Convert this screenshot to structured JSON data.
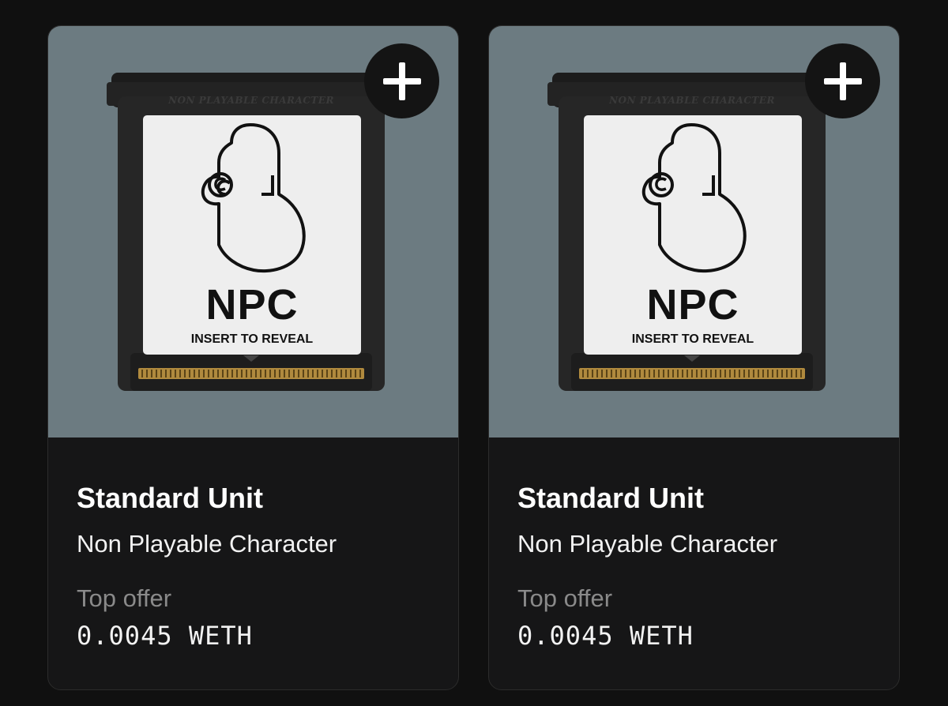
{
  "colors": {
    "page_background": "#101010",
    "card_background": "#161617",
    "media_background": "#6c7b81",
    "muted_text": "#8a8a8a"
  },
  "cards": [
    {
      "cartridge": {
        "top_text": "NON PLAYABLE CHARACTER",
        "logo_text": "NPC",
        "caption": "INSERT TO REVEAL",
        "icon": "npc-head-icon"
      },
      "add_icon": "plus-icon",
      "title": "Standard Unit",
      "collection": "Non Playable Character",
      "offer_label": "Top offer",
      "offer_value": "0.0045 WETH"
    },
    {
      "cartridge": {
        "top_text": "NON PLAYABLE CHARACTER",
        "logo_text": "NPC",
        "caption": "INSERT TO REVEAL",
        "icon": "npc-head-icon"
      },
      "add_icon": "plus-icon",
      "title": "Standard Unit",
      "collection": "Non Playable Character",
      "offer_label": "Top offer",
      "offer_value": "0.0045 WETH"
    }
  ]
}
